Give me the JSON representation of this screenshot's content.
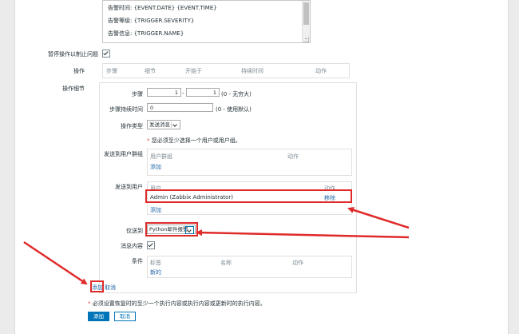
{
  "message_template": {
    "lines": [
      "告警时间: {EVENT.DATE} {EVENT.TIME}",
      "告警等级: {TRIGGER.SEVERITY}",
      "告警信息: {TRIGGER.NAME}"
    ]
  },
  "pause_ops": {
    "label": "暂停操作以制止问题",
    "checked": true
  },
  "operations": {
    "label": "操作",
    "columns": [
      "步骤",
      "细节",
      "开始于",
      "持续时间",
      "动作"
    ]
  },
  "op_details": {
    "label": "操作细节",
    "steps": {
      "label": "步骤",
      "from": "1",
      "to": "1",
      "dash": "-",
      "hint": "(0 - 无穷大)"
    },
    "step_duration": {
      "label": "步骤持续时间",
      "value": "0",
      "hint": "(0 - 使用默认)"
    },
    "op_type": {
      "label": "操作类型",
      "value": "发送消息"
    },
    "required_note": "至少选择一个用户或用户组。",
    "required_note_prefix": "您必须",
    "user_groups": {
      "label": "发送到用户群组",
      "col_group": "用户群组",
      "col_action": "动作",
      "add": "添加"
    },
    "users": {
      "label": "发送到用户",
      "col_user": "用户",
      "col_action": "动作",
      "row_user": "Admin (Zabbix Administrator)",
      "row_action": "移除",
      "add": "添加"
    },
    "send_only_to": {
      "label": "仅送到",
      "value": "Python邮件报警"
    },
    "message_content": {
      "label": "消息内容",
      "checked": true
    },
    "conditions": {
      "label": "条件",
      "col_label": "标签",
      "col_name": "名称",
      "col_action": "动作",
      "new": "新的"
    },
    "add_link": "添加",
    "cancel_link": "取消"
  },
  "footer_note": "必须设置恢复时的至少一个执行内容或执行内容或更新时的执行内容。",
  "buttons": {
    "add": "添加",
    "cancel": "取消"
  },
  "colors": {
    "accent": "#0275b8",
    "annotation": "#e02a2a"
  }
}
